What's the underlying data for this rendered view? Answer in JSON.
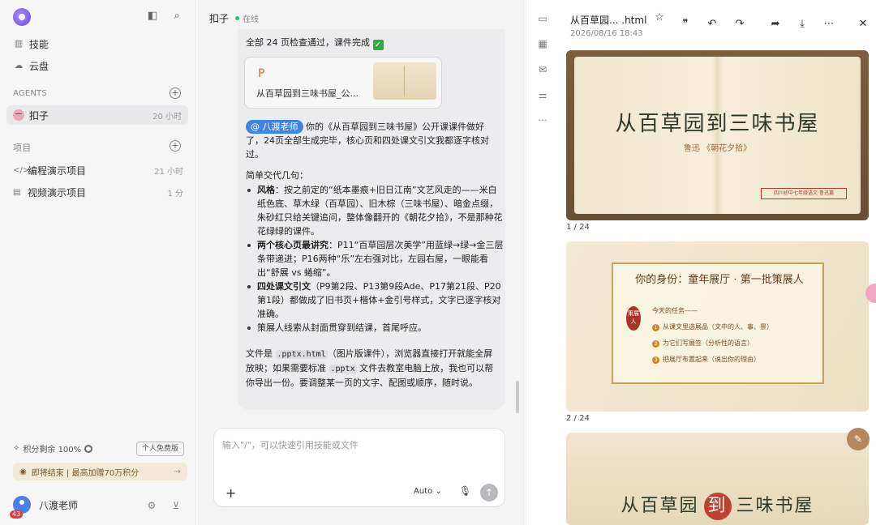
{
  "sidebar": {
    "nav": [
      {
        "label": "技能",
        "icon": "skills-icon"
      },
      {
        "label": "云盘",
        "icon": "cloud-icon"
      }
    ],
    "agents_header": "AGENTS",
    "agent": {
      "name": "扣子",
      "time": "20 小时"
    },
    "projects_header": "项目",
    "projects": [
      {
        "name": "编程演示项目",
        "time": "21 小时"
      },
      {
        "name": "视频演示项目",
        "time": "1 分"
      }
    ],
    "credits": "积分剩余 100%",
    "plan_badge": "个人免费版",
    "promo": "即将结束 | 最高加赠70万积分",
    "user_name": "八渡老师",
    "user_badge": "43"
  },
  "chat": {
    "agent_name": "扣子",
    "status": "在线",
    "top_line": "全部 24 页检查通过，课件完成",
    "file_card": {
      "letter": "P",
      "name": "从百草园到三味书屋_公..."
    },
    "mention": "@ 八渡老师",
    "intro": "你的《从百草园到三味书屋》公开课课件做好了，24页全部生成完毕，核心页和四处课文引文我都逐字核对过。",
    "summary_head": "简单交代几句：",
    "bullets": [
      {
        "bold": "风格",
        "text": "：按之前定的“纸本墨痕+旧日江南”文艺风走的——米白纸色底、草木绿（百草园）、旧木棕（三味书屋）、暗金点缀，朱砂红只给关键追问，整体像翻开的《朝花夕拾》，不是那种花花绿绿的课件。"
      },
      {
        "bold": "两个核心页最讲究",
        "text": "：P11“百草园层次美学”用蓝绿→绿→金三层条带递进；P16两种“乐”左右强对比，左园右屋，一眼能看出“舒展 vs 蜷缩”。"
      },
      {
        "bold": "四处课文引文",
        "text": "（P9第2段、P13第9段Ade、P17第21段、P20第1段）都做成了旧书页+楷体+金引号样式，文字已逐字核对准确。"
      },
      {
        "bold": "",
        "text": "策展人线索从封面贯穿到结课，首尾呼应。"
      }
    ],
    "closing_a": "文件是 ",
    "closing_code1": ".pptx.html",
    "closing_b": "（图片版课件），浏览器直接打开就能全屏放映；如果需要标准 ",
    "closing_code2": ".pptx",
    "closing_c": " 文件去教室电脑上放，我也可以帮你导出一份。要调整某一页的文字、配图或顺序，随时说。",
    "input_placeholder": "输入\"/\"，可以快速引用技能或文件",
    "model": "Auto"
  },
  "viewer": {
    "title": "从百草园... .html",
    "date": "2026/08/16 18:43",
    "slides": [
      {
        "title": "从百草园到三味书屋",
        "subtitle": "鲁迅 《朝花夕拾》",
        "seal": "四川初中七年级语文·鲁迅篇",
        "page": "1 / 24"
      },
      {
        "title": "你的身份：童年展厅 · 第一批策展人",
        "tag": "策展人",
        "tasks_head": "今天的任务——",
        "tasks": [
          "从课文里选展品（文中的人、事、景）",
          "为它们写展签（分析性的语言）",
          "把展厅布置起来（说出你的理由）"
        ],
        "page": "2 / 24"
      },
      {
        "left": "从百草园",
        "mid": "到",
        "right": "三味书屋"
      }
    ]
  }
}
